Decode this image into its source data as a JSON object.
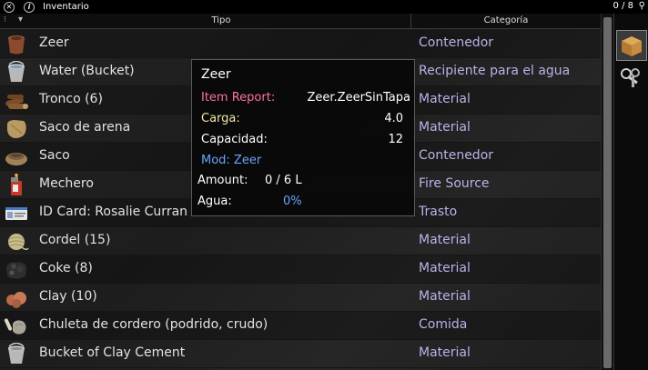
{
  "window": {
    "title": "Inventario",
    "count": "0 / 8",
    "close_glyph": "⊗",
    "info_glyph": "i"
  },
  "columns": {
    "type": "Tipo",
    "category": "Categoría"
  },
  "items": [
    {
      "name": "Zeer",
      "category": "Contenedor",
      "icon": "clay-pot-icon"
    },
    {
      "name": "Water (Bucket)",
      "category": "Recipiente para el agua",
      "icon": "bucket-icon"
    },
    {
      "name": "Tronco (6)",
      "category": "Material",
      "icon": "log-icon"
    },
    {
      "name": "Saco de arena",
      "category": "Material",
      "icon": "sandbag-icon"
    },
    {
      "name": "Saco",
      "category": "Contenedor",
      "icon": "sack-icon"
    },
    {
      "name": "Mechero",
      "category": "Fire Source",
      "icon": "lighter-icon"
    },
    {
      "name": "ID Card: Rosalie Curran",
      "category": "Trasto",
      "icon": "id-card-icon"
    },
    {
      "name": "Cordel (15)",
      "category": "Material",
      "icon": "twine-icon"
    },
    {
      "name": "Coke (8)",
      "category": "Material",
      "icon": "coke-icon"
    },
    {
      "name": "Clay (10)",
      "category": "Material",
      "icon": "clay-icon"
    },
    {
      "name": "Chuleta de cordero (podrido, crudo)",
      "category": "Comida",
      "icon": "lamb-chop-icon"
    },
    {
      "name": "Bucket of Clay Cement",
      "category": "Material",
      "icon": "bucket-cement-icon"
    }
  ],
  "tooltip": {
    "title": "Zeer",
    "item_report_label": "Item Report:",
    "item_report_value": "Zeer.ZeerSinTapa",
    "carga_label": "Carga:",
    "carga_value": "4.0",
    "capacidad_label": "Capacidad:",
    "capacidad_value": "12",
    "mod_label": "Mod: Zeer",
    "amount_label": "Amount:",
    "amount_value": "0 / 6 L",
    "agua_label": "Agua:",
    "agua_value": "0%"
  },
  "colors": {
    "category_text": "#b9b2e8",
    "item_report": "#ff6fa9",
    "label_yellow": "#f0e6a0",
    "mod_blue": "#6aa3ff"
  }
}
